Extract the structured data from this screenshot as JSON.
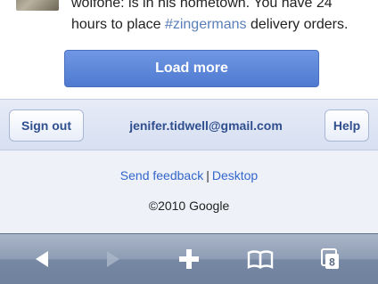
{
  "feed": {
    "line1": "wolfone: is in his hometown. You have 24",
    "line2_prefix": "hours to place ",
    "line2_hashtag": "#zingermans",
    "line2_suffix": " delivery orders."
  },
  "load_more_label": "Load more",
  "account": {
    "sign_out_label": "Sign out",
    "email": "jenifer.tidwell@gmail.com",
    "help_label": "Help"
  },
  "footer": {
    "feedback_link": "Send feedback",
    "separator": "|",
    "desktop_link": "Desktop",
    "copyright": "©2010 Google"
  },
  "toolbar": {
    "items": [
      {
        "icon": "back-arrow-icon"
      },
      {
        "icon": "forward-arrow-icon"
      },
      {
        "icon": "plus-icon"
      },
      {
        "icon": "bookmarks-book-icon"
      },
      {
        "icon": "pages-icon"
      }
    ],
    "pages_count": "8"
  },
  "colors": {
    "accent_blue": "#5a84d8",
    "link_blue": "#3366cc",
    "account_text": "#2f4f8f",
    "toolbar": "#8b9ab1"
  }
}
